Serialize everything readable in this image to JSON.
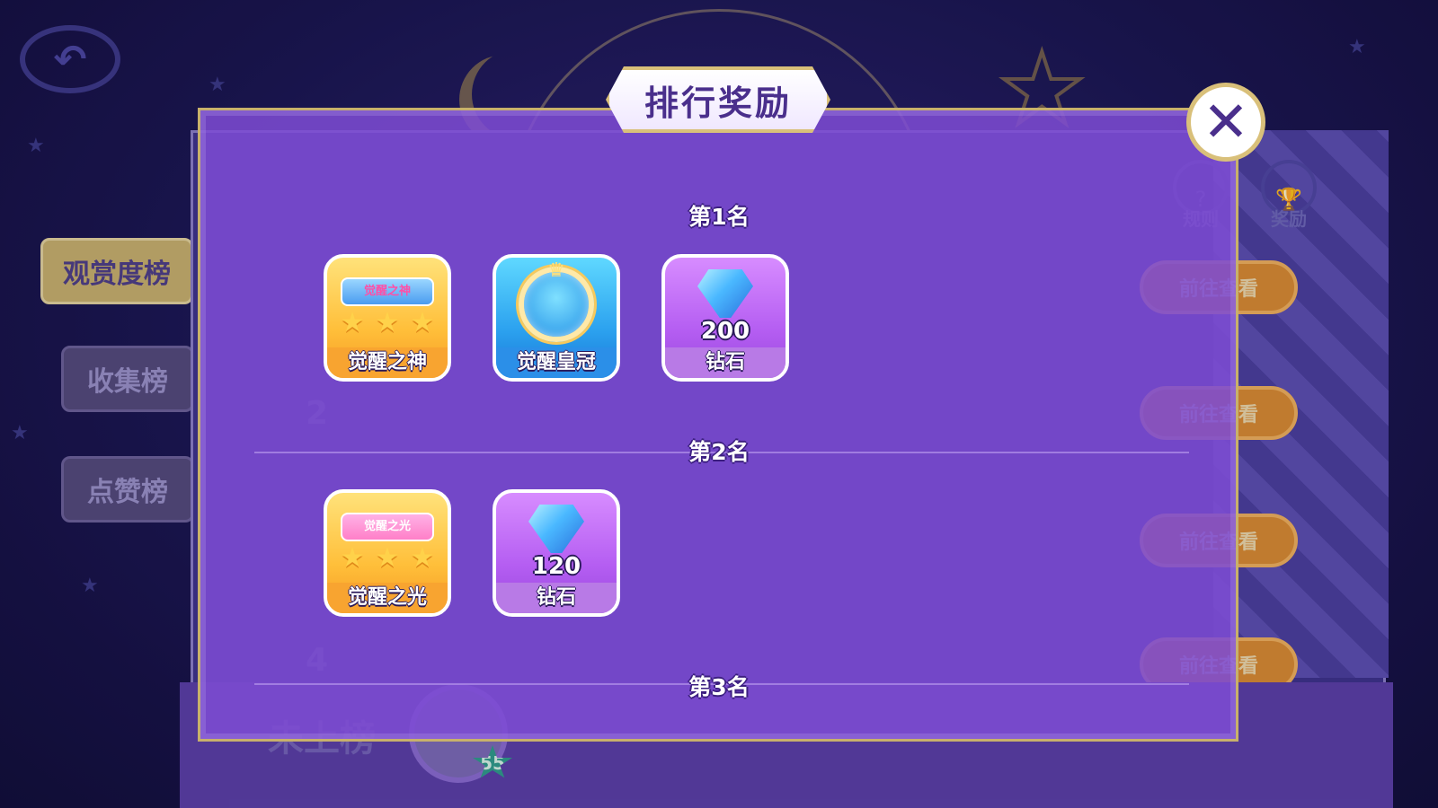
{
  "background": {
    "side_tabs": [
      "观赏度榜",
      "收集榜",
      "点赞榜"
    ],
    "header_icons": {
      "rules_label": "规则",
      "rewards_label": "奖励"
    },
    "go_button_label": "前往查看",
    "rank_numbers": [
      "2",
      "4"
    ],
    "unranked_label": "未上榜",
    "player_level": "55"
  },
  "modal": {
    "title": "排行奖励",
    "close_icon": "close-icon",
    "tiers": [
      {
        "label": "第1名",
        "rewards": [
          {
            "name": "觉醒之神",
            "kind": "title-badge",
            "banner": "觉醒之神"
          },
          {
            "name": "觉醒皇冠",
            "kind": "crown-frame"
          },
          {
            "name": "钻石",
            "kind": "diamond",
            "count": "200"
          }
        ]
      },
      {
        "label": "第2名",
        "rewards": [
          {
            "name": "觉醒之光",
            "kind": "title-badge",
            "banner": "觉醒之光"
          },
          {
            "name": "钻石",
            "kind": "diamond",
            "count": "120"
          }
        ]
      },
      {
        "label": "第3名",
        "rewards": []
      }
    ]
  },
  "colors": {
    "modal_fill": "#7e4cd4",
    "modal_border": "#c8b16b",
    "reward_gold": "#ffbf3a",
    "reward_blue": "#2ca2ef",
    "reward_purple": "#b55ef2"
  }
}
